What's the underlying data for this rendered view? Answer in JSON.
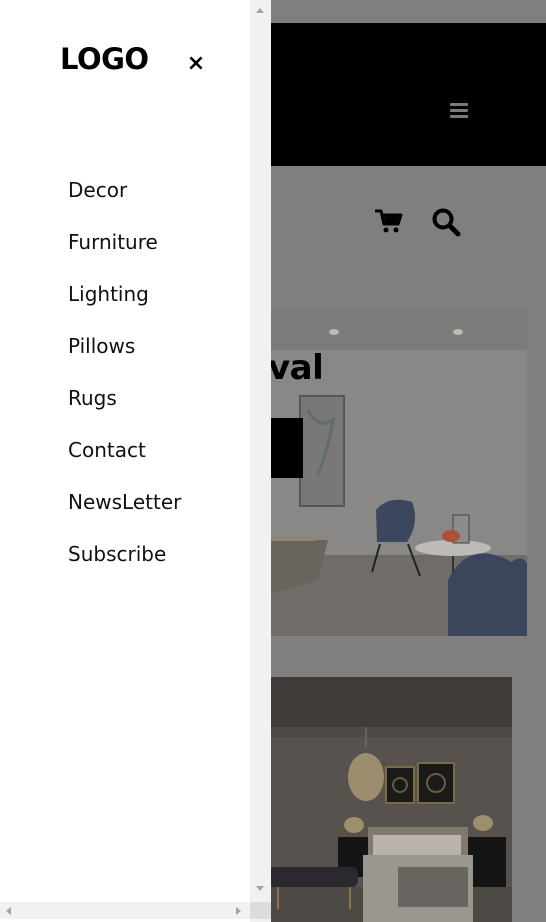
{
  "drawer": {
    "logo": "LOGO",
    "close_label": "×",
    "menu": [
      {
        "label": "Decor"
      },
      {
        "label": "Furniture"
      },
      {
        "label": "Lighting"
      },
      {
        "label": "Pillows"
      },
      {
        "label": "Rugs"
      },
      {
        "label": "Contact"
      },
      {
        "label": "NewsLetter"
      },
      {
        "label": "Subscribe"
      }
    ]
  },
  "header": {
    "menu_icon": "hamburger-icon",
    "cart_icon": "cart-icon",
    "search_icon": "search-icon"
  },
  "hero": {
    "title_visible": "val"
  },
  "colors": {
    "overlay": "#7f7f7f",
    "topbar": "#000000",
    "drawer": "#ffffff",
    "scrollbar": "#f1f1f1"
  }
}
